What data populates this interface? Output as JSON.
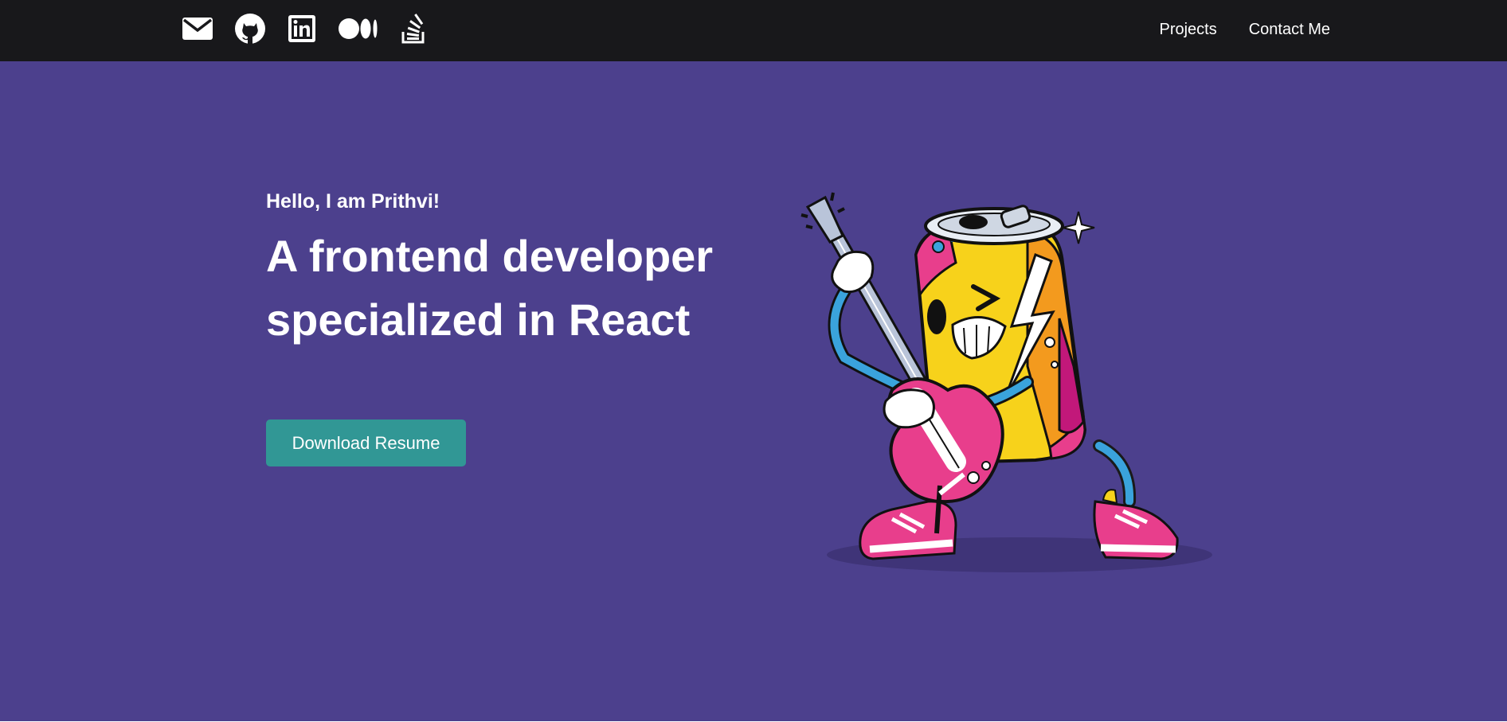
{
  "nav": {
    "social_icons": [
      "mail-icon",
      "github-icon",
      "linkedin-icon",
      "medium-icon",
      "stackoverflow-icon"
    ],
    "links": [
      "Projects",
      "Contact Me"
    ]
  },
  "hero": {
    "greeting": "Hello, I am Prithvi!",
    "headline_line1": "A frontend developer",
    "headline_line2": "specialized in React",
    "cta_label": "Download Resume",
    "illustration": "rock-can-guitar-illustration"
  },
  "colors": {
    "navbar": "#18181b",
    "hero_background": "#4c408d",
    "cta": "#319795",
    "text": "#ffffff"
  }
}
